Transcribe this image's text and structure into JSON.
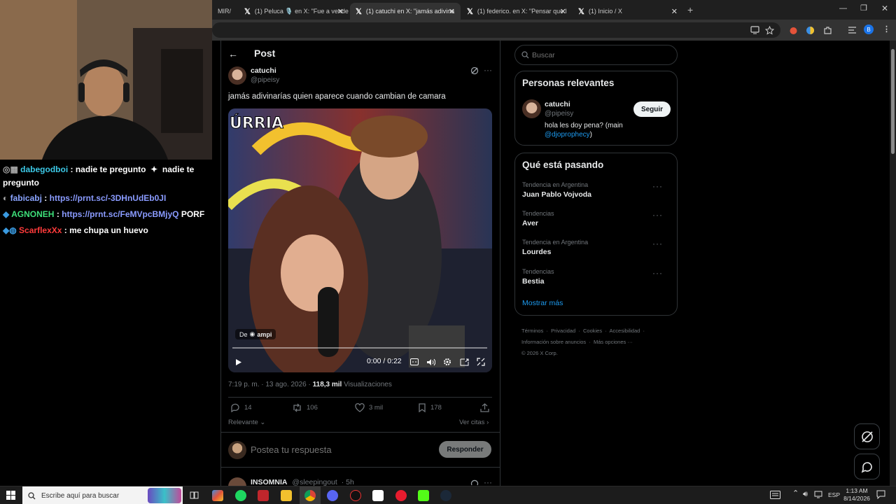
{
  "browser": {
    "tabs": [
      {
        "label": "MIR/"
      },
      {
        "label": "(1) Peluca 🎙️ en X: \"Fue a vende"
      },
      {
        "label": "(1) catuchi en X: \"jamás adivina"
      },
      {
        "label": "(1) federico. en X: \"Pensar que l"
      },
      {
        "label": "(1) Inicio / X"
      }
    ],
    "new_tab": "+",
    "profile_initial": "B"
  },
  "header": {
    "title": "Post"
  },
  "post": {
    "author_name": "catuchi",
    "author_handle": "@pipeisy",
    "text": "jamás adivinarías quien aparece cuando cambian de camara",
    "video_banner": "ÚRRIA",
    "video_source_prefix": "De",
    "video_source_name": "ampi",
    "video_time": "0:00 / 0:22",
    "meta_time": "7:19 p. m. · 13 ago. 2026 · ",
    "views_count": "118,3 mil",
    "views_label": " Visualizaciones",
    "replies": "14",
    "reposts": "106",
    "likes": "3 mil",
    "bookmarks": "178",
    "relevance": "Relevante",
    "view_quotes": "Ver citas",
    "reply_placeholder": "Postea tu respuesta",
    "reply_button": "Responder"
  },
  "next_reply": {
    "name": "INSOMNIA",
    "handle": "@sleepingout",
    "time": "· 5h"
  },
  "search": {
    "placeholder": "Buscar"
  },
  "relevant": {
    "title": "Personas relevantes",
    "name": "catuchi",
    "handle": "@pipeisy",
    "follow": "Seguir",
    "bio_prefix": "hola les doy pena? (main ",
    "bio_mention": "@djoprophecy",
    "bio_suffix": ")"
  },
  "trends": {
    "title": "Qué está pasando",
    "items": [
      {
        "caption": "Tendencia en Argentina",
        "name": "Juan Pablo Vojvoda"
      },
      {
        "caption": "Tendencias",
        "name": "Aver"
      },
      {
        "caption": "Tendencia en Argentina",
        "name": "Lourdes"
      },
      {
        "caption": "Tendencias",
        "name": "Bestia"
      }
    ],
    "show_more": "Mostrar más"
  },
  "footer": {
    "links1": [
      "Términos",
      "Privacidad",
      "Cookies",
      "Accesibilidad"
    ],
    "links2": [
      "Información sobre anuncios",
      "Más opciones ···"
    ],
    "copyright": "© 2026 X Corp."
  },
  "chat": [
    {
      "user": "dabegodboi",
      "user_color": "#3cc8e6",
      "msg": ": nadie te pregunto",
      "msg2": "nadie te",
      "msg3": "pregunto"
    },
    {
      "user": "fabicabj",
      "user_color": "#8aa4ff",
      "msg": ":",
      "link": "https://prnt.sc/-3DHnUdEb0JI"
    },
    {
      "user": "AGNONEH",
      "user_color": "#3ee07a",
      "msg": ":",
      "link": "https://prnt.sc/FeMVpcBMjyQ",
      "tail": "PORF"
    },
    {
      "user": "ScarflexXx",
      "user_color": "#ff3b3b",
      "msg": ": me chupa un huevo"
    }
  ],
  "taskbar": {
    "search_placeholder": "Escribe aquí para buscar",
    "lang": "ESP",
    "time": "1:13 AM",
    "date": "8/14/2026"
  },
  "colors": {
    "x_blue": "#1d9bf0",
    "link": "#8a9bff",
    "accent": "#1d9bf0"
  }
}
